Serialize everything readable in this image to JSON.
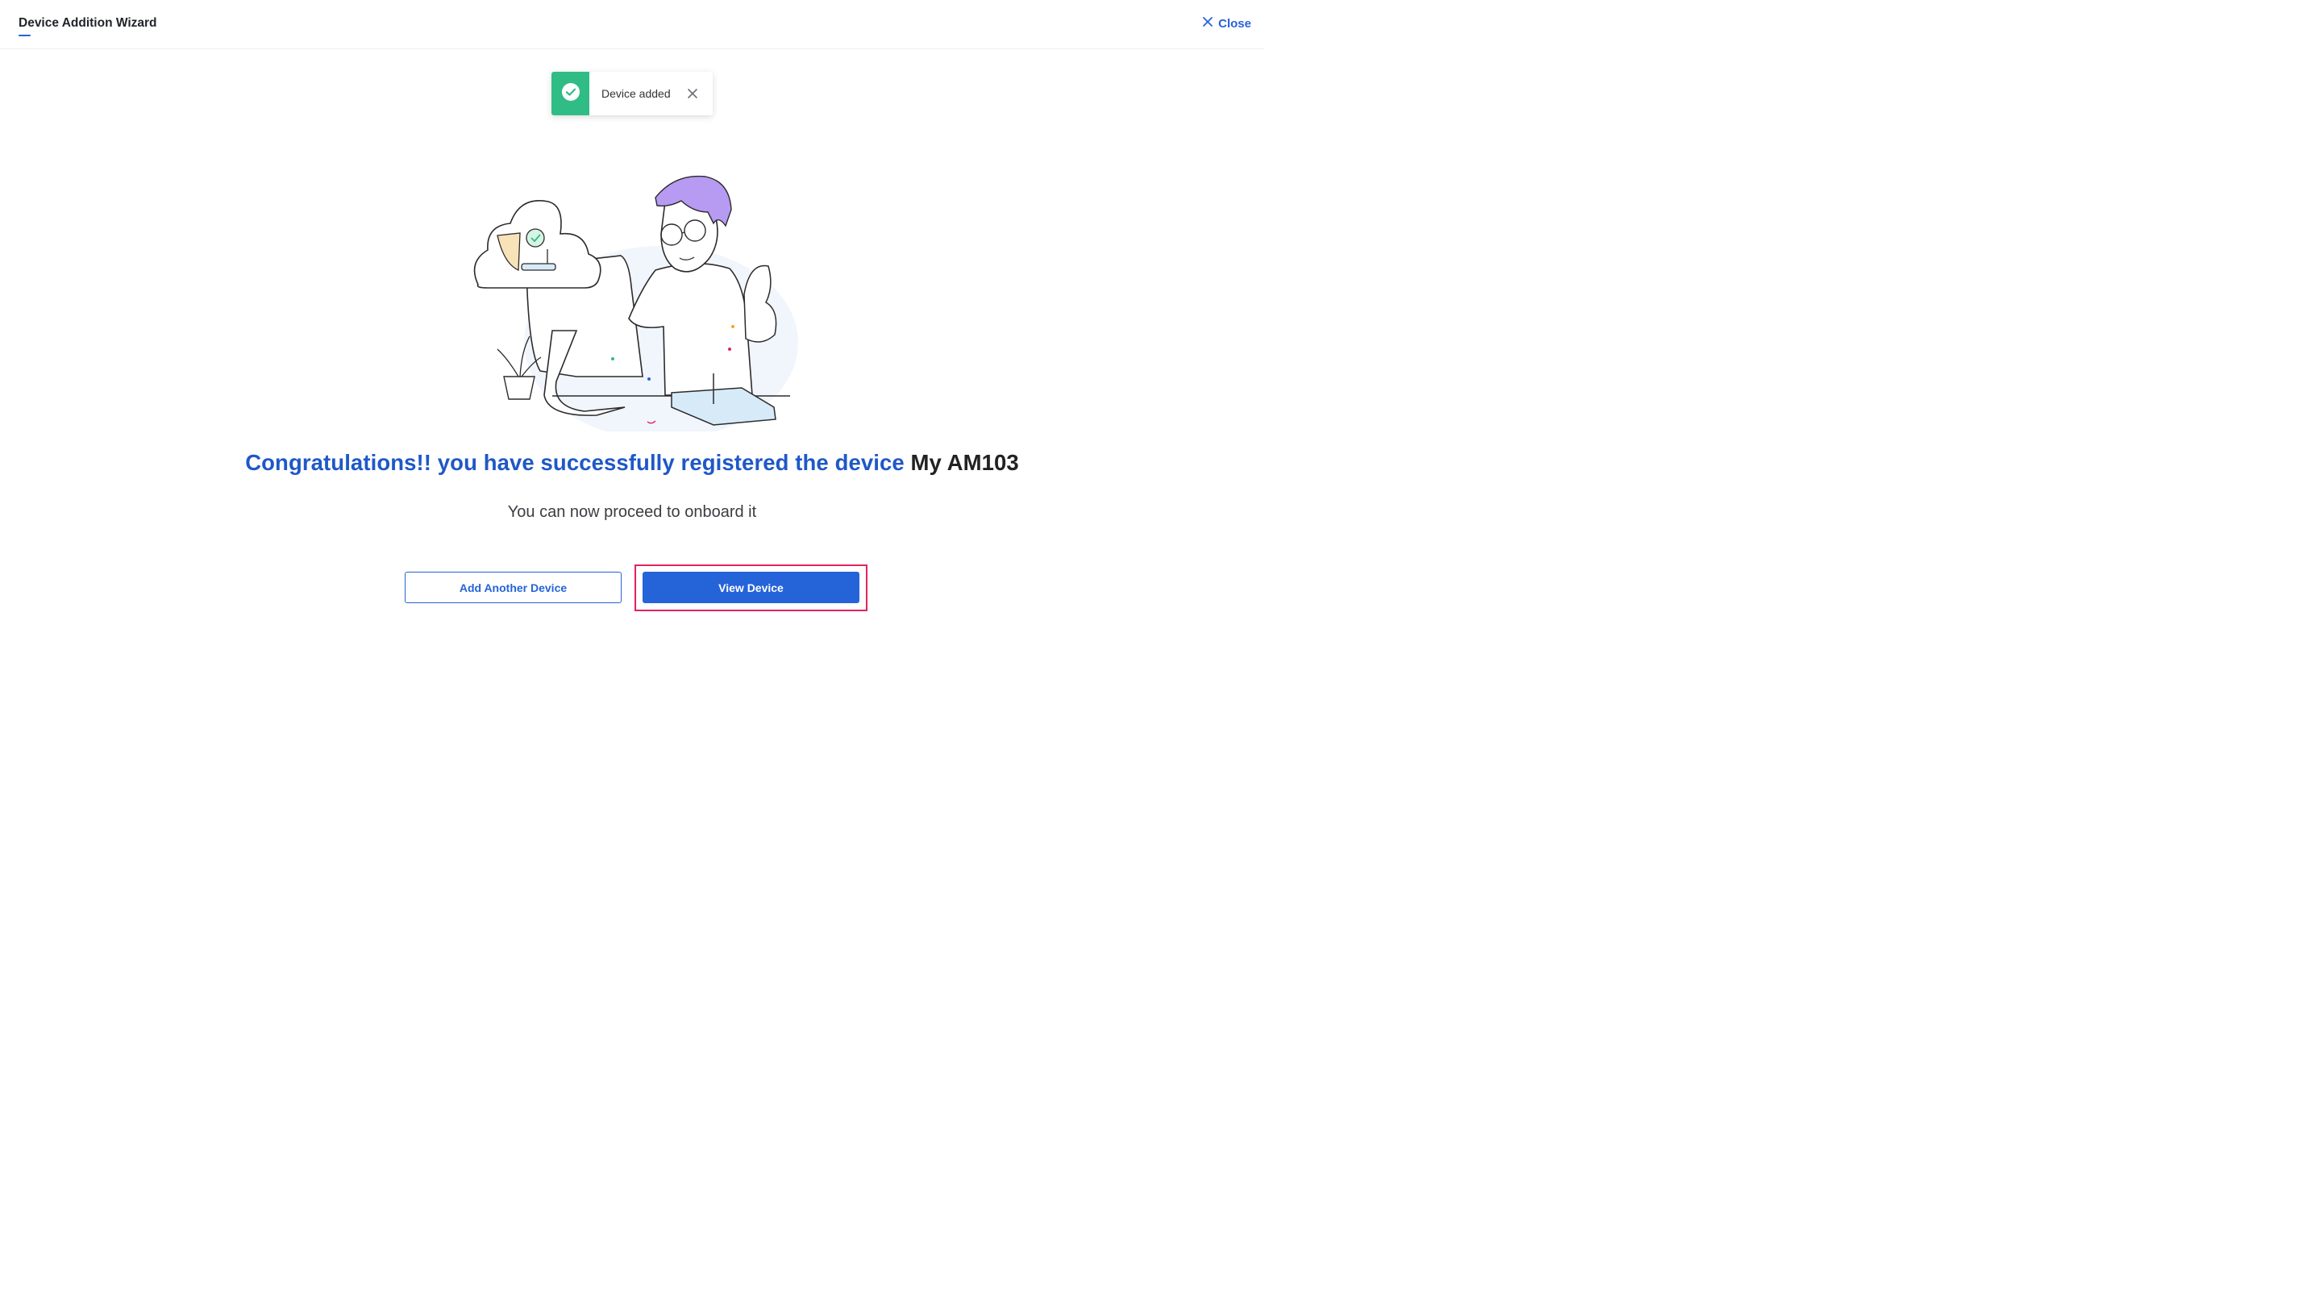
{
  "header": {
    "title": "Device Addition Wizard",
    "close_label": "Close"
  },
  "toast": {
    "message": "Device added",
    "icon": "check-circle-icon",
    "accent_color": "#2fbd85"
  },
  "main": {
    "headline_text": "Congratulations!! you have successfully registered the device",
    "device_name": "My AM103",
    "subline": "You can now proceed to onboard it"
  },
  "actions": {
    "secondary_label": "Add Another Device",
    "primary_label": "View Device"
  },
  "colors": {
    "brand": "#2563d9",
    "headline": "#1f58c7",
    "highlight": "#e0245e"
  }
}
